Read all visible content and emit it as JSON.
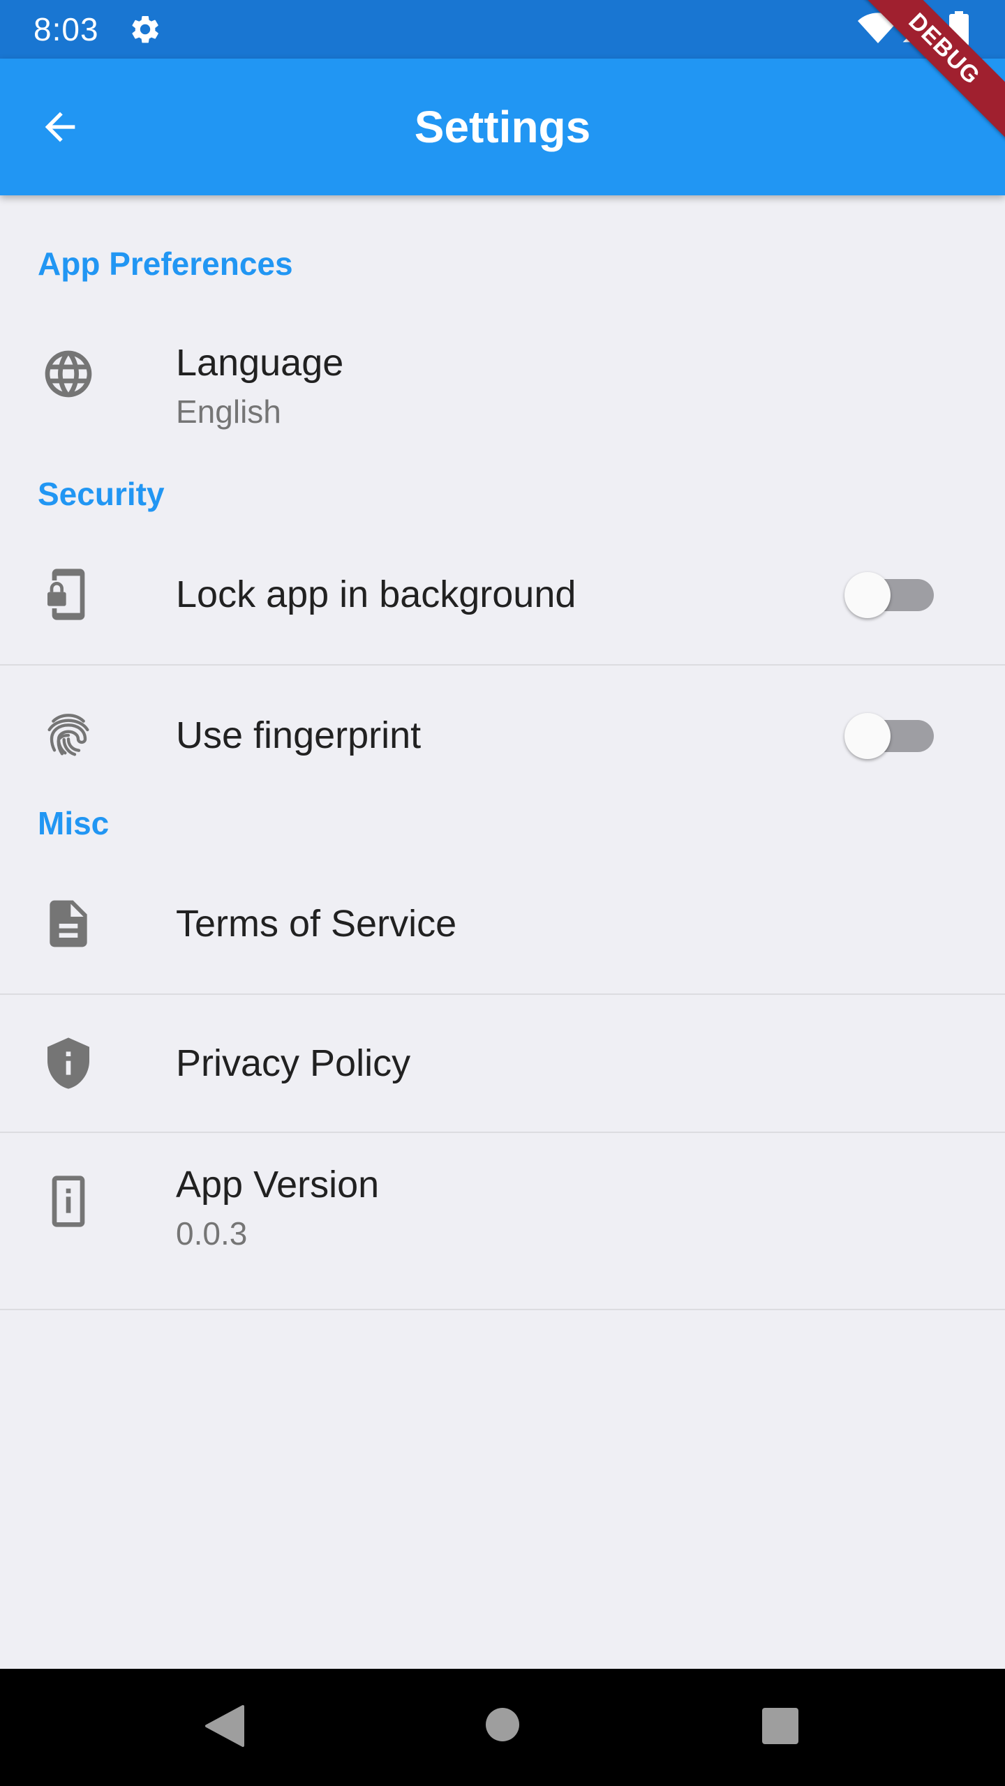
{
  "status_bar": {
    "time": "8:03",
    "icons": [
      "gear-icon",
      "wifi-icon",
      "signal-icon",
      "battery-icon"
    ]
  },
  "app_bar": {
    "title": "Settings",
    "back_icon": "arrow-back-icon"
  },
  "debug_banner": "DEBUG",
  "colors": {
    "status_bar": "#1976d2",
    "app_bar": "#2196f3",
    "accent": "#2196f3",
    "background": "#efeff4",
    "icon": "#757575",
    "debug": "#a0202f"
  },
  "sections": {
    "app_preferences": {
      "header": "App Preferences",
      "language": {
        "title": "Language",
        "value": "English",
        "icon": "globe-icon"
      }
    },
    "security": {
      "header": "Security",
      "lock_app": {
        "title": "Lock app in background",
        "icon": "phone-lock-icon",
        "enabled": false
      },
      "fingerprint": {
        "title": "Use fingerprint",
        "icon": "fingerprint-icon",
        "enabled": false
      }
    },
    "misc": {
      "header": "Misc",
      "terms": {
        "title": "Terms of Service",
        "icon": "document-icon"
      },
      "privacy": {
        "title": "Privacy Policy",
        "icon": "shield-info-icon"
      },
      "version": {
        "title": "App Version",
        "value": "0.0.3",
        "icon": "info-phone-icon"
      }
    }
  },
  "nav_bar": {
    "icons": [
      "nav-back-icon",
      "nav-home-icon",
      "nav-recents-icon"
    ]
  }
}
